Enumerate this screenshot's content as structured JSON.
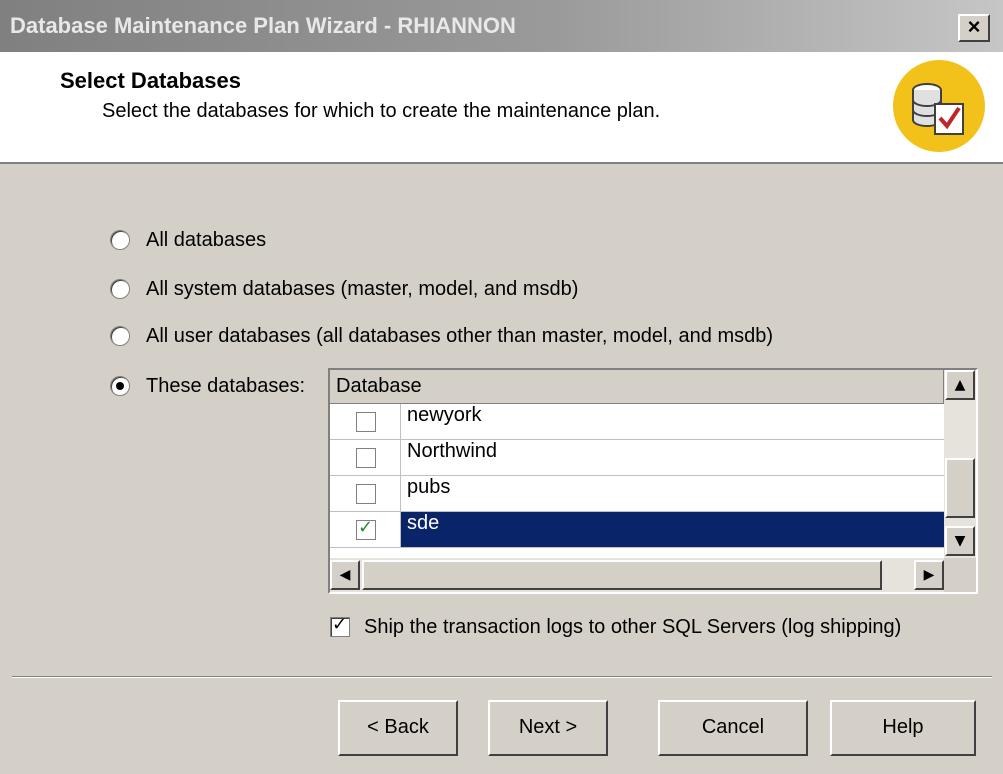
{
  "window": {
    "title": "Database Maintenance Plan Wizard - RHIANNON",
    "close_label": "×"
  },
  "header": {
    "title": "Select Databases",
    "subtitle": "Select the databases for which to create the maintenance plan.",
    "icon": "database-check-icon"
  },
  "options": [
    {
      "label": "All databases",
      "selected": false
    },
    {
      "label": "All system databases (master, model, and msdb)",
      "selected": false
    },
    {
      "label": "All user databases (all databases other than master, model, and msdb)",
      "selected": false
    },
    {
      "label": "These databases:",
      "selected": true
    }
  ],
  "database_list": {
    "column_header": "Database",
    "rows": [
      {
        "name": "newyork",
        "checked": false,
        "selected": false
      },
      {
        "name": "Northwind",
        "checked": false,
        "selected": false
      },
      {
        "name": "pubs",
        "checked": false,
        "selected": false
      },
      {
        "name": "sde",
        "checked": true,
        "selected": true
      }
    ],
    "scroll_up": "▲",
    "scroll_down": "▼",
    "scroll_left": "◀",
    "scroll_right": "▶"
  },
  "ship_logs": {
    "label": "Ship the transaction logs to other SQL Servers (log shipping)",
    "checked": true
  },
  "buttons": {
    "back": "< Back",
    "next": "Next >",
    "cancel": "Cancel",
    "help": "Help"
  },
  "colors": {
    "selection": "#0a246a",
    "icon_bg": "#f2c21a"
  }
}
